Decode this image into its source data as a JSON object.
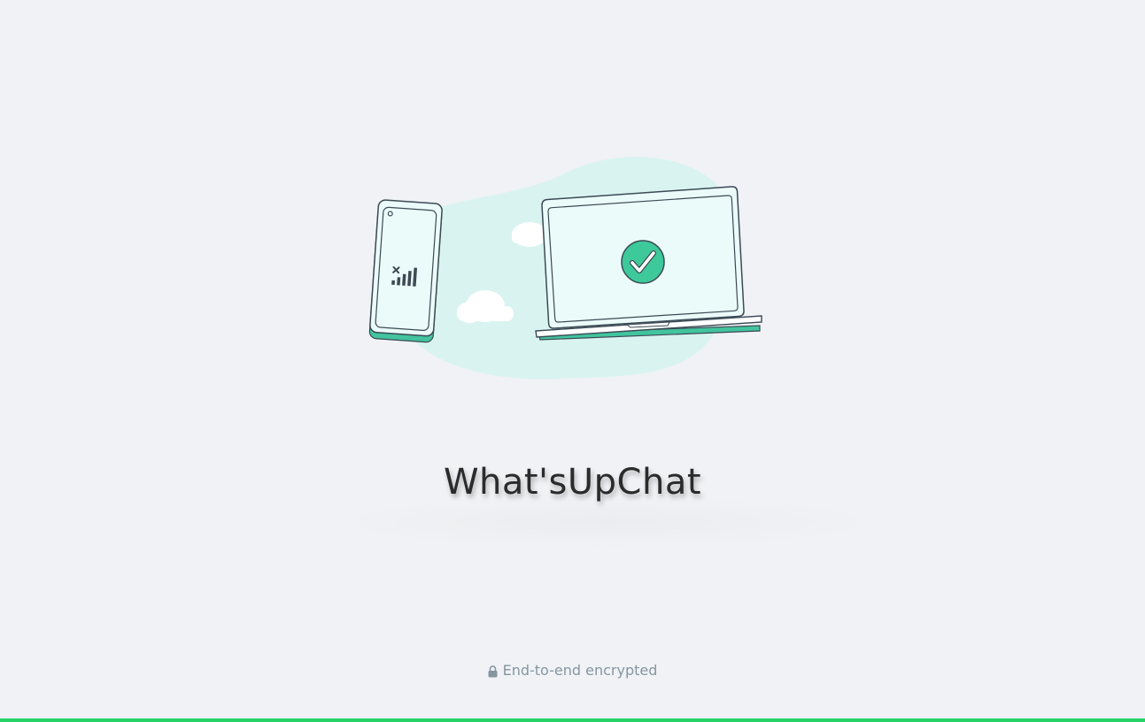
{
  "app": {
    "title": "What'sUpChat"
  },
  "footer": {
    "text": "End-to-end encrypted",
    "icon": "lock-icon"
  },
  "illustration": {
    "name": "phone-laptop-connected-illustration"
  },
  "colors": {
    "background": "#f0f2f5",
    "accent": "#25d366",
    "check_green": "#3ec99a",
    "blob": "#d9f4f0",
    "outline": "#3b4a54",
    "muted_text": "#8696a0"
  }
}
